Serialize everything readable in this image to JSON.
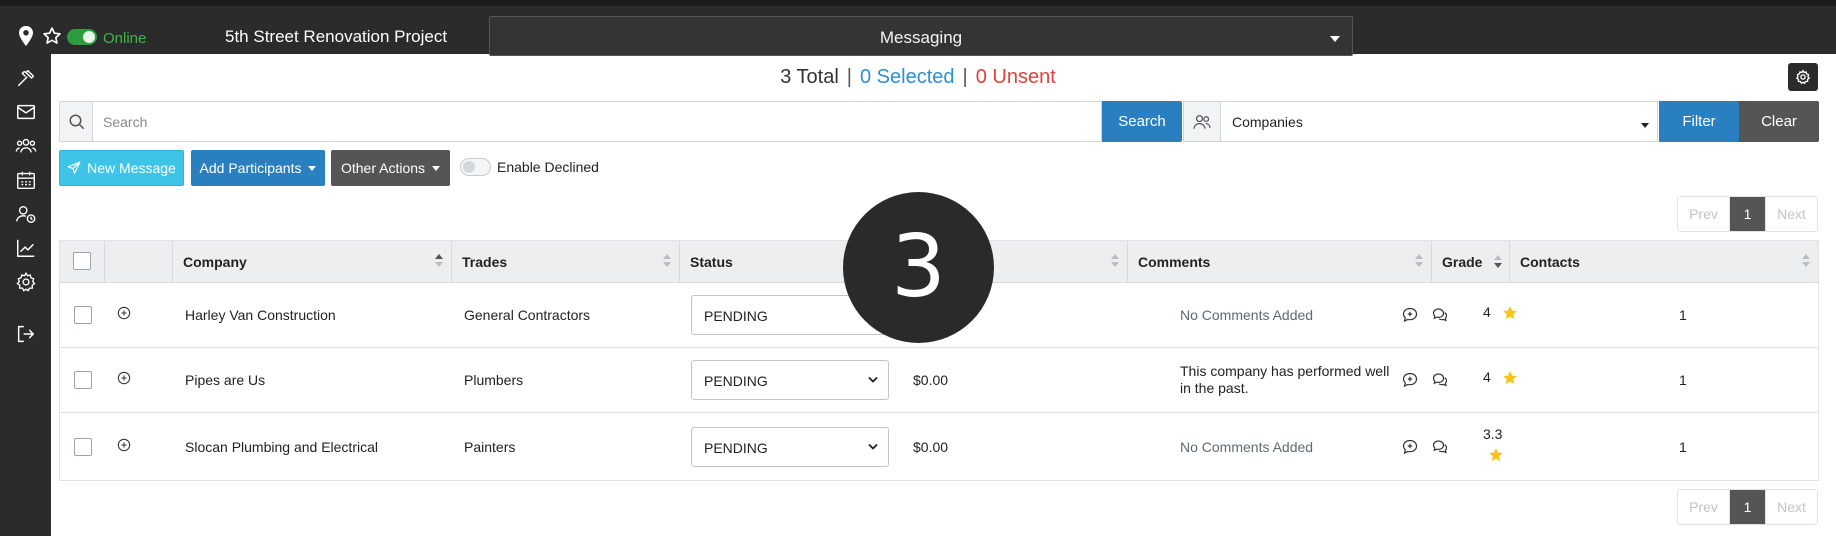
{
  "topbar": {
    "status_label": "Online",
    "project_title": "5th Street Renovation Project",
    "module_selected": "Messaging"
  },
  "sidebar": {
    "items": [
      {
        "icon": "hammer-icon"
      },
      {
        "icon": "envelope-icon"
      },
      {
        "icon": "users-icon"
      },
      {
        "icon": "calendar-icon"
      },
      {
        "icon": "user-clock-icon"
      },
      {
        "icon": "chart-line-icon"
      },
      {
        "icon": "gear-icon"
      },
      {
        "icon": "sign-out-icon"
      }
    ]
  },
  "counts": {
    "total": "3 Total",
    "selected": "0 Selected",
    "unsent": "0 Unsent",
    "separator": "|"
  },
  "search": {
    "placeholder": "Search",
    "button_label": "Search",
    "filter_selected": "Companies",
    "filter_button": "Filter",
    "clear_button": "Clear"
  },
  "actions": {
    "new_message": "New Message",
    "add_participants": "Add Participants",
    "other_actions": "Other Actions",
    "enable_declined": "Enable Declined"
  },
  "pagination": {
    "prev": "Prev",
    "page": "1",
    "next": "Next"
  },
  "table": {
    "columns": [
      "Company",
      "Trades",
      "Status",
      "Comments",
      "Grade",
      "Contacts"
    ],
    "rows": [
      {
        "company": "Harley Van Construction",
        "trades": "General Contractors",
        "status": "PENDING",
        "amount": "",
        "comments": "No Comments Added",
        "comments_empty": true,
        "grade": "4",
        "contacts": "1"
      },
      {
        "company": "Pipes are Us",
        "trades": "Plumbers",
        "status": "PENDING",
        "amount": "$0.00",
        "comments": "This company has performed well in the past.",
        "comments_empty": false,
        "grade": "4",
        "contacts": "1"
      },
      {
        "company": "Slocan Plumbing and Electrical",
        "trades": "Painters",
        "status": "PENDING",
        "amount": "$0.00",
        "comments": "No Comments Added",
        "comments_empty": true,
        "grade": "3.3",
        "contacts": "1"
      }
    ]
  },
  "overlay": {
    "badge": "3"
  },
  "colors": {
    "topbar": "#2b2b2b",
    "online_green": "#3db54a",
    "primary_blue": "#2a7fc1",
    "cyan_button": "#3ec4e8",
    "dark_gray_button": "#555555",
    "selected_blue": "#2b8fd6",
    "unsent_red": "#e0423c",
    "star_yellow": "#f5c518"
  }
}
